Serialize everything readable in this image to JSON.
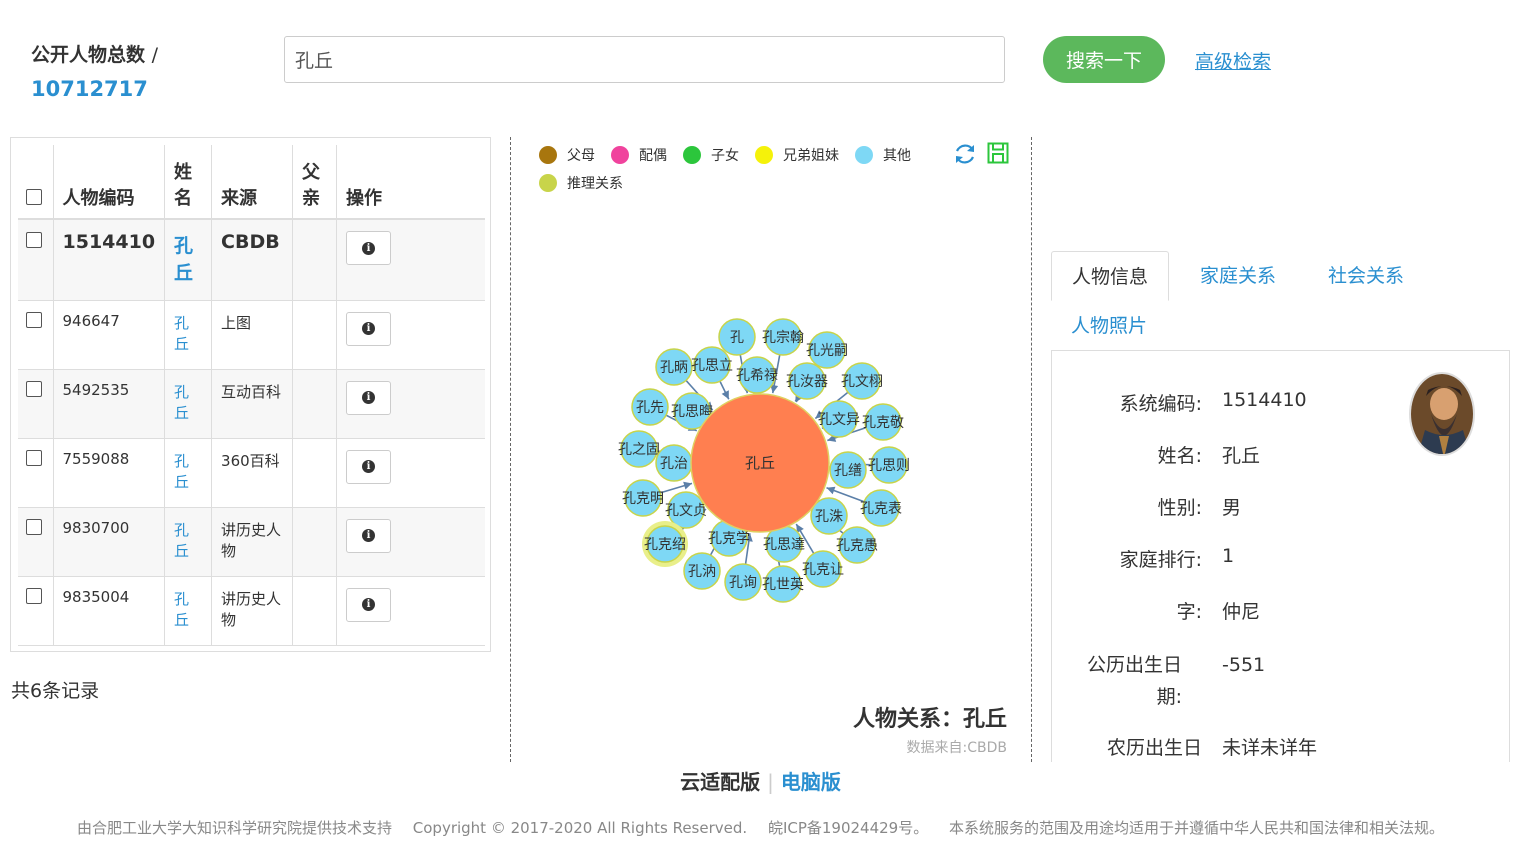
{
  "header": {
    "total_label": "公开人物总数",
    "total_slash": "/",
    "total_count": "10712717",
    "search_value": "孔丘",
    "search_button": "搜索一下",
    "advanced_link": "高级检索"
  },
  "table": {
    "headers": {
      "id": "人物编码",
      "name": "姓名",
      "source": "来源",
      "father": "父亲",
      "action": "操作"
    },
    "rows": [
      {
        "id": "1514410",
        "name": "孔丘",
        "source": "CBDB",
        "father": ""
      },
      {
        "id": "946647",
        "name": "孔丘",
        "source": "上图",
        "father": ""
      },
      {
        "id": "5492535",
        "name": "孔丘",
        "source": "互动百科",
        "father": ""
      },
      {
        "id": "7559088",
        "name": "孔丘",
        "source": "360百科",
        "father": ""
      },
      {
        "id": "9830700",
        "name": "孔丘",
        "source": "讲历史人物",
        "father": ""
      },
      {
        "id": "9835004",
        "name": "孔丘",
        "source": "讲历史人物",
        "father": ""
      }
    ],
    "record_count": "共6条记录"
  },
  "graph": {
    "legend": [
      {
        "label": "父母",
        "color": "#a8760e"
      },
      {
        "label": "配偶",
        "color": "#f0439d"
      },
      {
        "label": "子女",
        "color": "#2cc63c"
      },
      {
        "label": "兄弟姐妹",
        "color": "#f5f20a"
      },
      {
        "label": "其他",
        "color": "#7ed8f5"
      },
      {
        "label": "推理关系",
        "color": "#c8d44a"
      }
    ],
    "center": "孔丘",
    "center_color": "#ff7f50",
    "node_color": "#7ed8f5",
    "highlight_color": "#e9ef8a",
    "nodes": [
      {
        "label": "孔"
      },
      {
        "label": "孔宗翰"
      },
      {
        "label": "孔光嗣"
      },
      {
        "label": "孔昞"
      },
      {
        "label": "孔思立"
      },
      {
        "label": "孔希禄"
      },
      {
        "label": "孔汝器"
      },
      {
        "label": "孔文栩"
      },
      {
        "label": "孔先"
      },
      {
        "label": "孔思晦"
      },
      {
        "label": "孔文异"
      },
      {
        "label": "孔克敬"
      },
      {
        "label": "孔之固"
      },
      {
        "label": "孔治"
      },
      {
        "label": "孔缮"
      },
      {
        "label": "孔思则"
      },
      {
        "label": "孔克明"
      },
      {
        "label": "孔文贞"
      },
      {
        "label": "孔洙"
      },
      {
        "label": "孔克表"
      },
      {
        "label": "孔克绍"
      },
      {
        "label": "孔克学"
      },
      {
        "label": "孔思達"
      },
      {
        "label": "孔克愚"
      },
      {
        "label": "孔汭"
      },
      {
        "label": "孔询"
      },
      {
        "label": "孔世英"
      },
      {
        "label": "孔克让"
      }
    ],
    "title": "人物关系：孔丘",
    "source": "数据来自:CBDB"
  },
  "info": {
    "tabs": [
      "人物信息",
      "家庭关系",
      "社会关系",
      "人物照片"
    ],
    "fields": [
      {
        "label": "系统编码:",
        "value": "1514410"
      },
      {
        "label": "姓名:",
        "value": "孔丘"
      },
      {
        "label": "性别:",
        "value": "男"
      },
      {
        "label": "家庭排行:",
        "value": "1"
      },
      {
        "label": "字:",
        "value": "仲尼"
      },
      {
        "label": "公历出生日期:",
        "value": "-551"
      },
      {
        "label": "农历出生日",
        "value": "未详未详年"
      }
    ]
  },
  "footer": {
    "cloud": "云适配版",
    "sep": "|",
    "pc": "电脑版",
    "support": "由合肥工业大学大知识科学研究院提供技术支持",
    "copyright": "Copyright © 2017-2020 All Rights Reserved.",
    "icp": "皖ICP备19024429号。",
    "notice": "本系统服务的范围及用途均适用于并遵循中华人民共和国法律和相关法规。"
  }
}
